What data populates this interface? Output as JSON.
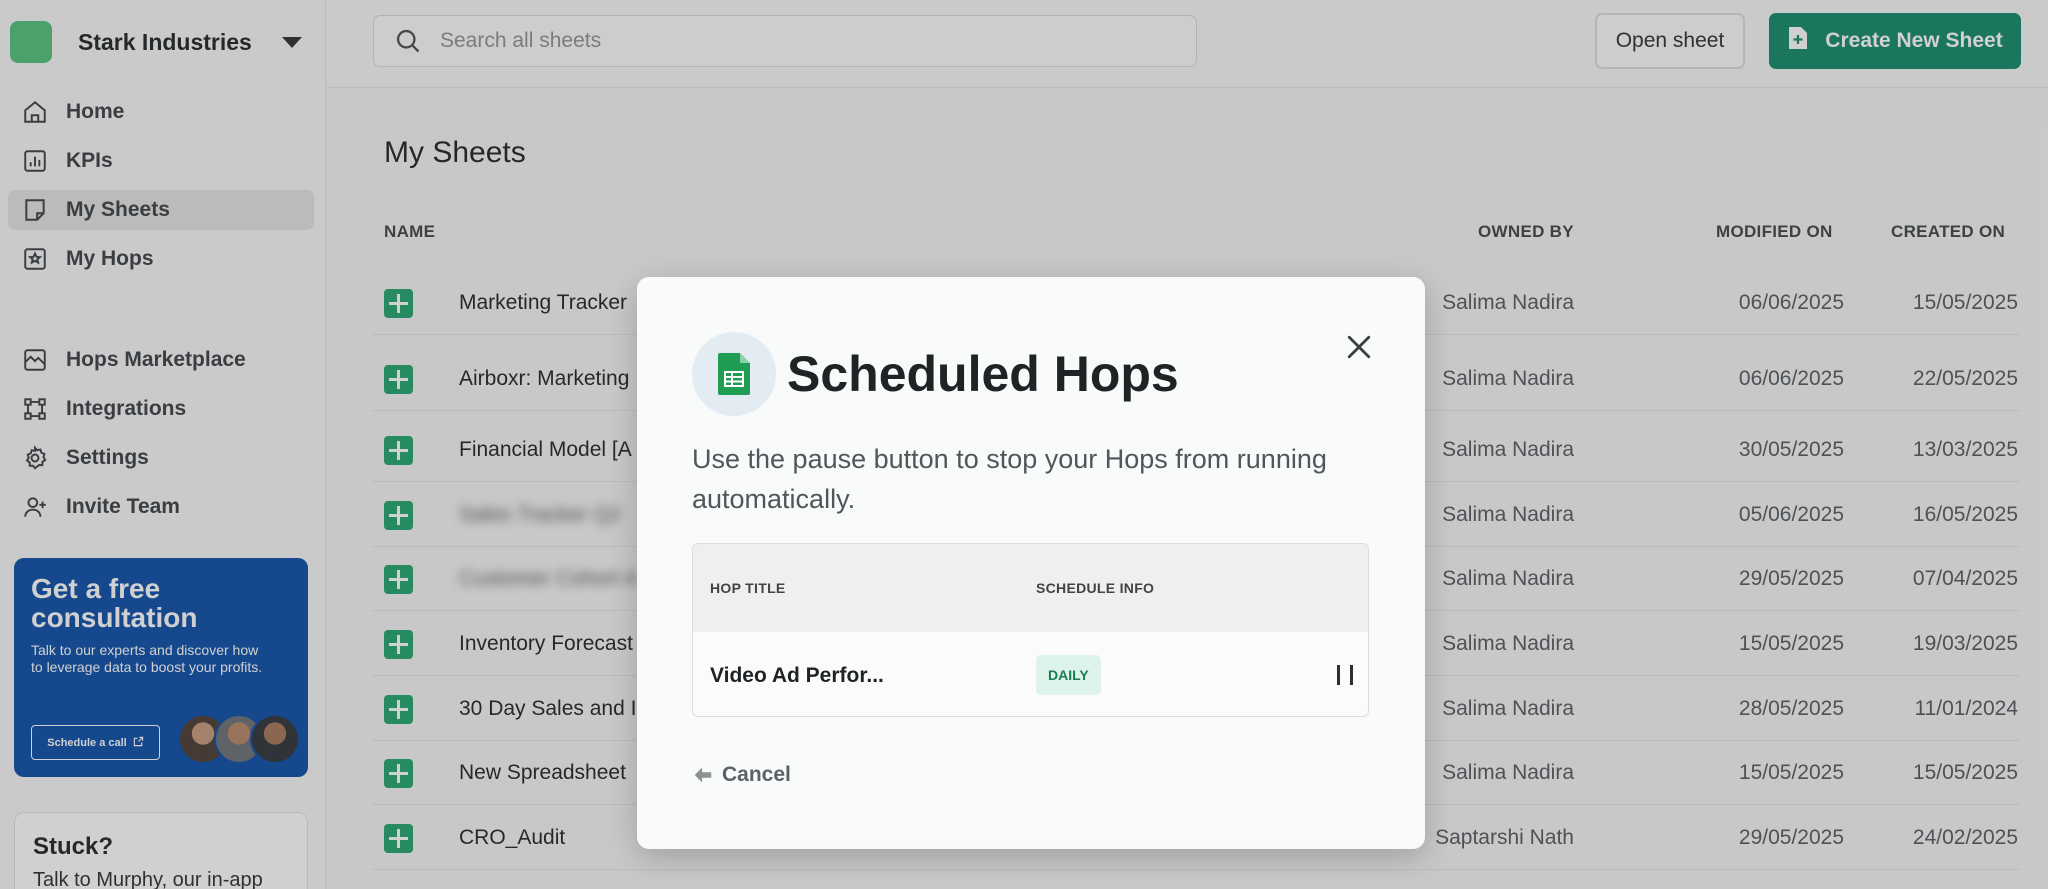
{
  "org": {
    "name": "Stark Industries"
  },
  "sidebar": {
    "items": [
      {
        "label": "Home",
        "icon": "home-icon"
      },
      {
        "label": "KPIs",
        "icon": "chart-icon"
      },
      {
        "label": "My Sheets",
        "icon": "sheet-icon",
        "active": true
      },
      {
        "label": "My Hops",
        "icon": "bookmark-star-icon"
      },
      {
        "label": "Hops Marketplace",
        "icon": "marketplace-icon"
      },
      {
        "label": "Integrations",
        "icon": "integrations-icon"
      },
      {
        "label": "Settings",
        "icon": "gear-icon"
      },
      {
        "label": "Invite Team",
        "icon": "add-user-icon"
      }
    ],
    "promo": {
      "title": "Get a free consultation",
      "text": "Talk to our experts and discover how to leverage data to boost your profits.",
      "button": "Schedule a call"
    },
    "stuck": {
      "title": "Stuck?",
      "text": "Talk to Murphy, our in-app"
    }
  },
  "header": {
    "search_placeholder": "Search all sheets",
    "open_sheet": "Open sheet",
    "create_sheet": "Create New Sheet"
  },
  "main": {
    "title": "My Sheets",
    "columns": {
      "name": "NAME",
      "owner": "OWNED BY",
      "modified": "MODIFIED ON",
      "created": "CREATED ON"
    },
    "rows": [
      {
        "name": "Marketing Tracker",
        "owner": "Salima Nadira",
        "modified": "06/06/2025",
        "created": "15/05/2025"
      },
      {
        "name": "Airboxr: Marketing",
        "owner": "Salima Nadira",
        "modified": "06/06/2025",
        "created": "22/05/2025"
      },
      {
        "name": "Financial Model [A",
        "owner": "Salima Nadira",
        "modified": "30/05/2025",
        "created": "13/03/2025"
      },
      {
        "name": "Sales Tracker Q2",
        "owner": "Salima Nadira",
        "modified": "05/06/2025",
        "created": "16/05/2025",
        "blurred": true
      },
      {
        "name": "Customer Cohort A",
        "owner": "Salima Nadira",
        "modified": "29/05/2025",
        "created": "07/04/2025",
        "blurred": true
      },
      {
        "name": "Inventory Forecast",
        "owner": "Salima Nadira",
        "modified": "15/05/2025",
        "created": "19/03/2025"
      },
      {
        "name": "30 Day Sales and I",
        "owner": "Salima Nadira",
        "modified": "28/05/2025",
        "created": "11/01/2024"
      },
      {
        "name": "New Spreadsheet",
        "owner": "Salima Nadira",
        "modified": "15/05/2025",
        "created": "15/05/2025"
      },
      {
        "name": "CRO_Audit",
        "owner": "Saptarshi Nath",
        "modified": "29/05/2025",
        "created": "24/02/2025"
      }
    ]
  },
  "modal": {
    "title": "Scheduled Hops",
    "description": "Use the pause button to stop your Hops from running automatically.",
    "columns": {
      "hop_title": "HOP TITLE",
      "schedule": "SCHEDULE INFO"
    },
    "hops": [
      {
        "title": "Video Ad Perfor...",
        "schedule": "DAILY"
      }
    ],
    "cancel": "Cancel"
  },
  "colors": {
    "brand_green": "#118a6a",
    "sheet_green": "#23a46d",
    "promo_blue": "#0a4da8",
    "badge_bg": "#def3ea"
  }
}
